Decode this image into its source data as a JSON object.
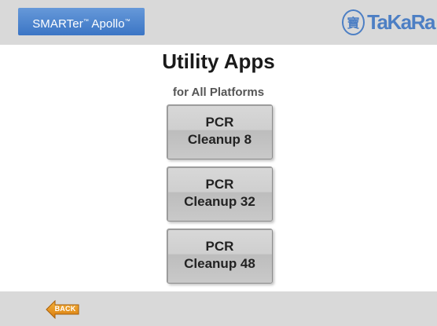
{
  "header": {
    "brand": {
      "name": "SMARTer",
      "name_mark": "™",
      "product": "Apollo",
      "product_mark": "™"
    },
    "logo": {
      "seal_glyph": "寶",
      "text": "TaKaRa",
      "icon": "takara-seal-icon"
    }
  },
  "main": {
    "title": "Utility Apps",
    "subtitle": "for All Platforms",
    "apps": [
      {
        "line1": "PCR",
        "line2": "Cleanup 8"
      },
      {
        "line1": "PCR",
        "line2": "Cleanup 32"
      },
      {
        "line1": "PCR",
        "line2": "Cleanup 48"
      }
    ]
  },
  "footer": {
    "back_label": "BACK",
    "back_icon": "left-arrow-icon"
  },
  "colors": {
    "header_bg": "#d9d9d9",
    "brand_blue": "#3b75c5",
    "logo_blue": "#4d7fc4",
    "back_orange": "#e8951a"
  }
}
